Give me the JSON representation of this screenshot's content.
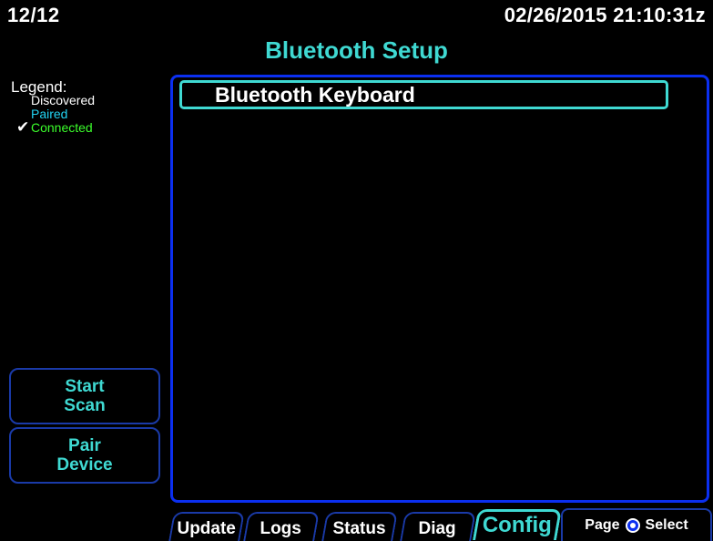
{
  "header": {
    "page_index": "12/12",
    "datetime": "02/26/2015 21:10:31z",
    "title": "Bluetooth Setup"
  },
  "legend": {
    "title": "Legend:",
    "discovered": "Discovered",
    "paired": "Paired",
    "connected": "Connected",
    "connected_mark": "✔",
    "colors": {
      "discovered": "#ffffff",
      "paired": "#22d3f2",
      "connected": "#3cff2c"
    }
  },
  "side_buttons": {
    "start_scan": [
      "Start",
      "Scan"
    ],
    "pair_device": [
      "Pair",
      "Device"
    ]
  },
  "devices": [
    {
      "name": "Bluetooth Keyboard",
      "selected": true
    }
  ],
  "tabs": [
    {
      "label": "Update",
      "active": false
    },
    {
      "label": "Logs",
      "active": false
    },
    {
      "label": "Status",
      "active": false
    },
    {
      "label": "Diag",
      "active": false
    },
    {
      "label": "Config",
      "active": true
    }
  ],
  "hint": {
    "left": "Page",
    "knob_icon": "knob-icon",
    "right": "Select"
  },
  "colors": {
    "accent": "#3fd9d2",
    "border_blue": "#0b2ff0"
  }
}
